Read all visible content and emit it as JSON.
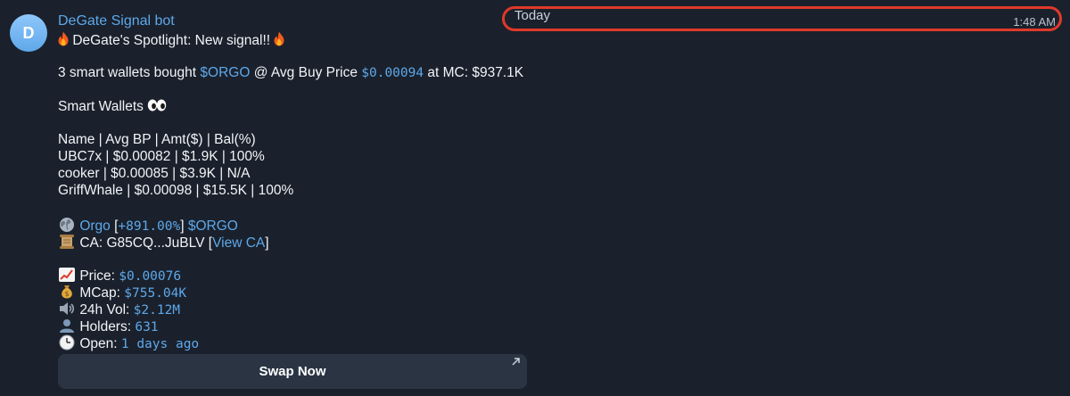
{
  "chat": {
    "avatar_letter": "D",
    "sender_name": "DeGate Signal bot",
    "date_label": "Today",
    "time": "1:48 AM"
  },
  "message": {
    "headline": "DeGate's Spotlight: New signal!!",
    "buy_prefix": "3 smart wallets bought",
    "token_link": "$ORGO",
    "buy_mid": "@ Avg Buy Price",
    "avg_price": "$0.00094",
    "buy_suffix": "at MC: $937.1K",
    "smart_wallets_title": "Smart Wallets",
    "table_header": "Name | Avg BP | Amt($) | Bal(%)",
    "wallet_rows": [
      "UBC7x | $0.00082 | $1.9K | 100%",
      "cooker | $0.00085 | $3.9K | N/A",
      "GriffWhale | $0.00098 | $15.5K | 100%"
    ],
    "token_name": "Orgo",
    "token_change": "+891.00%",
    "token_ticker": "$ORGO",
    "ca_label": "CA: G85CQ...JuBLV",
    "view_ca_link": "View CA",
    "stats": {
      "price_label": "Price:",
      "price_value": "$0.00076",
      "mcap_label": "MCap:",
      "mcap_value": "$755.04K",
      "vol_label": "24h Vol:",
      "vol_value": "$2.12M",
      "holders_label": "Holders:",
      "holders_value": "631",
      "open_label": "Open:",
      "open_value": "1 days ago"
    },
    "swap_button": "Swap Now"
  },
  "colors": {
    "background": "#1a212c",
    "link": "#5ea8ea",
    "highlight_border": "#e0392a",
    "button_bg": "#2a3443"
  },
  "icons": [
    "fire-icon",
    "eyes-icon",
    "globe-icon",
    "scroll-icon",
    "chart-increasing-icon",
    "money-bag-icon",
    "speaker-icon",
    "user-icon",
    "clock-icon",
    "external-arrow-icon"
  ]
}
